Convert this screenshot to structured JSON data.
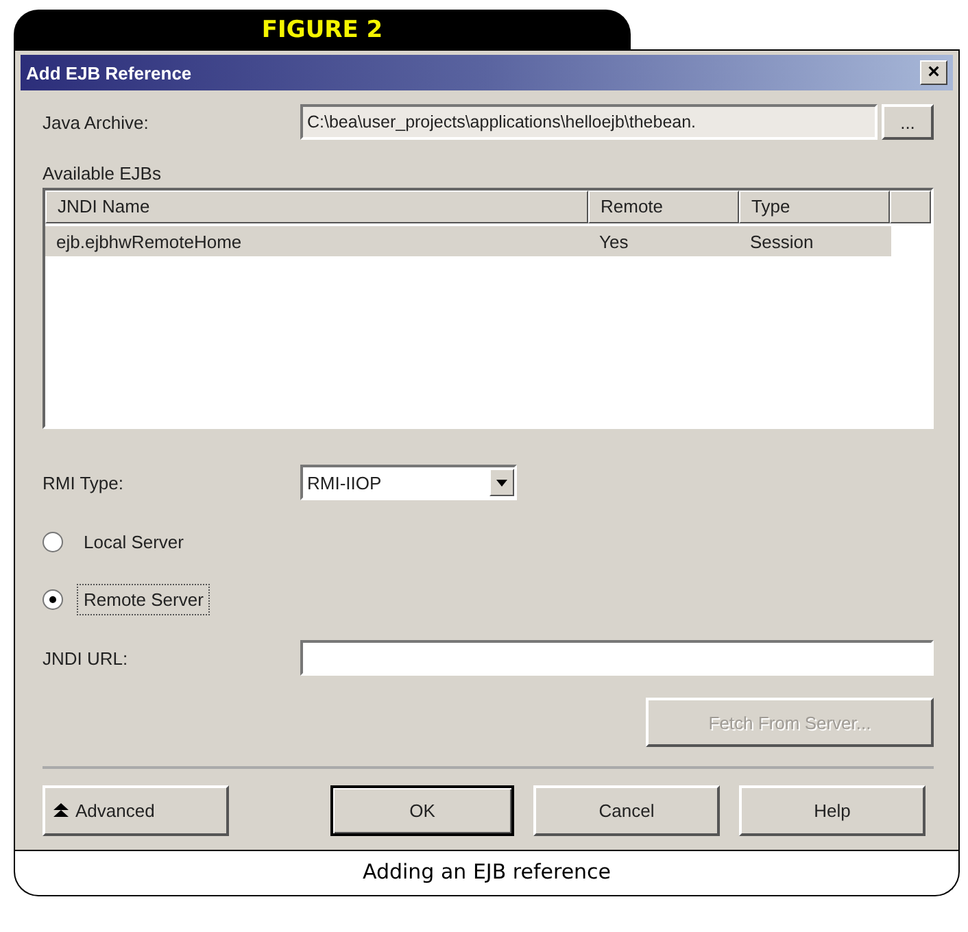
{
  "figure_label": "FIGURE 2",
  "window": {
    "title": "Add EJB Reference",
    "close": "×"
  },
  "java_archive": {
    "label": "Java Archive:",
    "value": "C:\\bea\\user_projects\\applications\\helloejb\\thebean.",
    "browse": "..."
  },
  "ejbs": {
    "label": "Available EJBs",
    "columns": [
      "JNDI Name",
      "Remote",
      "Type"
    ],
    "rows": [
      {
        "cells": [
          "ejb.ejbhwRemoteHome",
          "Yes",
          "Session"
        ],
        "selected": true
      }
    ]
  },
  "rmi_type": {
    "label": "RMI Type:",
    "value": "RMI-IIOP"
  },
  "servers": [
    {
      "label": "Local Server",
      "selected": false
    },
    {
      "label": "Remote Server",
      "selected": true
    }
  ],
  "jndi_url": {
    "label": "JNDI URL:"
  },
  "fetch_button": {
    "label": "Fetch From Server...",
    "disabled": true
  },
  "buttons": [
    {
      "label": "Advanced",
      "kind": "advanced"
    },
    {
      "label": "OK",
      "kind": "default"
    },
    {
      "label": "Cancel",
      "kind": "plain"
    },
    {
      "label": "Help",
      "kind": "plain"
    }
  ],
  "caption": "Adding an EJB reference"
}
